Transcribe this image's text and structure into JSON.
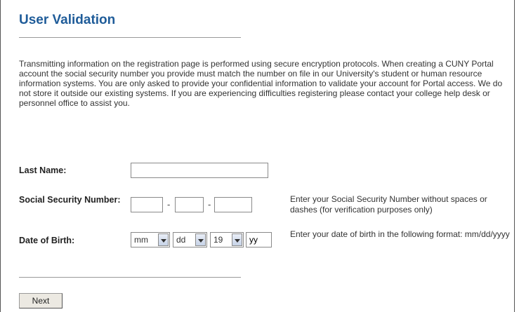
{
  "page": {
    "title": "User Validation",
    "intro": "Transmitting information on the registration page is performed using secure encryption protocols. When creating a CUNY Portal account the social security number you provide must match the number on file in our University's student or human resource information systems. You are only asked to provide your confidential information to validate your account for Portal access. We do not store it outside our existing systems. If you are experiencing difficulties registering please contact your college help desk or personnel office to assist you."
  },
  "form": {
    "last_name": {
      "label": "Last Name:",
      "value": ""
    },
    "ssn": {
      "label": "Social Security Number:",
      "part1": "",
      "part2": "",
      "part3": "",
      "separator": "-",
      "help": "Enter your Social Security Number without spaces or dashes (for verification purposes only)"
    },
    "dob": {
      "label": "Date of Birth:",
      "month": "mm",
      "day": "dd",
      "century": "19",
      "year": "yy",
      "help": "Enter your date of birth in the following format: mm/dd/yyyy"
    }
  },
  "actions": {
    "next_label": "Next"
  }
}
